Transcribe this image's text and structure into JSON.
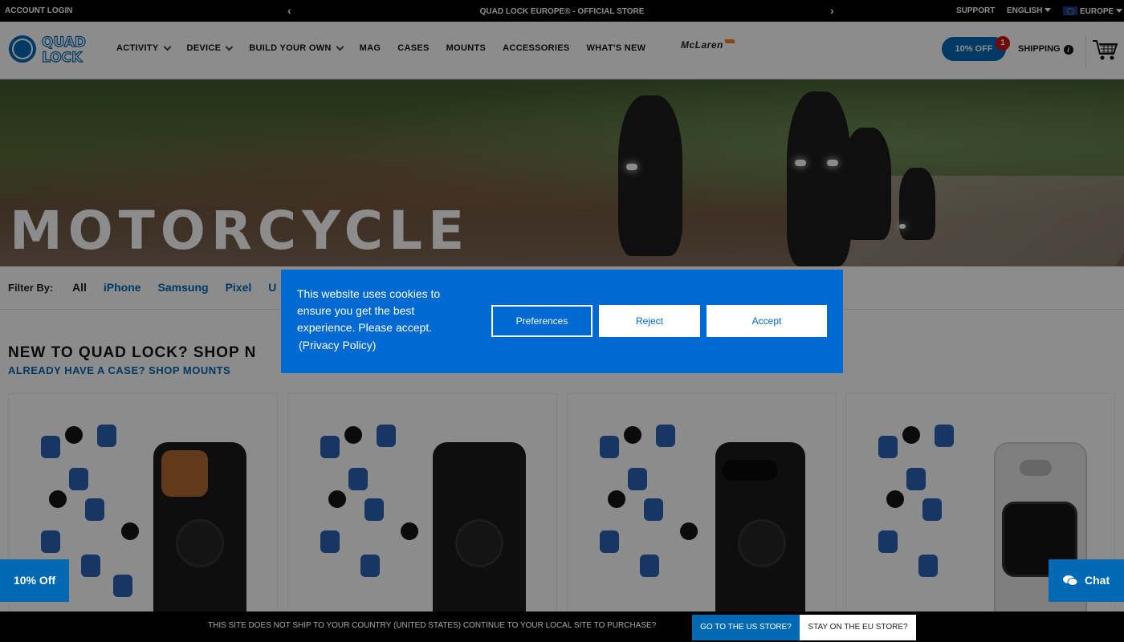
{
  "topbar": {
    "account": "ACCOUNT LOGIN",
    "promo": "QUAD LOCK EUROPE® - OFFICIAL STORE",
    "support": "SUPPORT",
    "language": "ENGLISH",
    "region": "EUROPE"
  },
  "header": {
    "nav": [
      {
        "label": "ACTIVITY",
        "dropdown": true
      },
      {
        "label": "DEVICE",
        "dropdown": true
      },
      {
        "label": "BUILD YOUR OWN",
        "dropdown": true
      },
      {
        "label": "MAG"
      },
      {
        "label": "CASES"
      },
      {
        "label": "MOUNTS"
      },
      {
        "label": "ACCESSORIES"
      },
      {
        "label": "WHAT'S NEW"
      }
    ],
    "partner": "McLaren",
    "offer": "10% OFF",
    "offer_badge": "1",
    "shipping": "SHIPPING"
  },
  "hero": {
    "title": "MOTORCYCLE"
  },
  "filter": {
    "label": "Filter By:",
    "options": [
      "All",
      "iPhone",
      "Samsung",
      "Pixel",
      "U"
    ],
    "active": "All"
  },
  "section": {
    "heading": "NEW TO QUAD LOCK? SHOP N",
    "subheading": "ALREADY HAVE A CASE? SHOP MOUNTS"
  },
  "cookie": {
    "message": "This website uses cookies to ensure you get the best experience. Please accept.",
    "privacy": "(Privacy Policy)",
    "preferences": "Preferences",
    "reject": "Reject",
    "accept": "Accept"
  },
  "side": {
    "discount": "10% Off",
    "chat": "Chat"
  },
  "bottombar": {
    "message": "THIS SITE DOES NOT SHIP TO YOUR COUNTRY (UNITED STATES) CONTINUE TO YOUR LOCAL SITE TO PURCHASE?",
    "us": "GO TO THE US STORE?",
    "eu": "STAY ON THE EU STORE?"
  },
  "colors": {
    "brand_blue": "#0069b4",
    "cookie_blue": "#0069d2",
    "badge_red": "#d01010"
  }
}
